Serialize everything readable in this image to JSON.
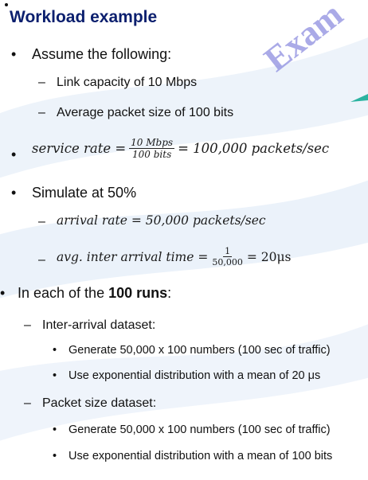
{
  "slide": {
    "title": "Workload example",
    "watermark": "Exam",
    "assume": "Assume the following:",
    "link_capacity": "Link capacity of 10 Mbps",
    "avg_packet_size": "Average packet size of 100 bits",
    "service_rate": {
      "lhs": "service rate =",
      "num": "10 Mbps",
      "den": "100 bits",
      "rhs": "= 100,000 packets/sec"
    },
    "simulate": "Simulate at 50%",
    "arrival_rate": "arrival rate = 50,000 packets/sec",
    "inter_arrival": {
      "lhs": "avg. inter arrival time =",
      "num": "1",
      "den": "50,000",
      "rhs": "= 20μs"
    },
    "runs": {
      "prefix": "In each of the ",
      "bold": "100 runs",
      "suffix": ":"
    },
    "inter_arrival_dataset": {
      "label": "Inter-arrival dataset:",
      "items": [
        "Generate 50,000 x 100 numbers (100 sec of traffic)",
        "Use exponential distribution with a mean of 20 μs"
      ]
    },
    "packet_size_dataset": {
      "label": "Packet size dataset:",
      "items": [
        "Generate 50,000 x 100 numbers (100 sec of traffic)",
        "Use exponential distribution with a mean of 100 bits"
      ]
    },
    "colors": {
      "title": "#0b1f6e",
      "watermark": "#8e8ee0",
      "wave": "#dfe9f6"
    }
  }
}
